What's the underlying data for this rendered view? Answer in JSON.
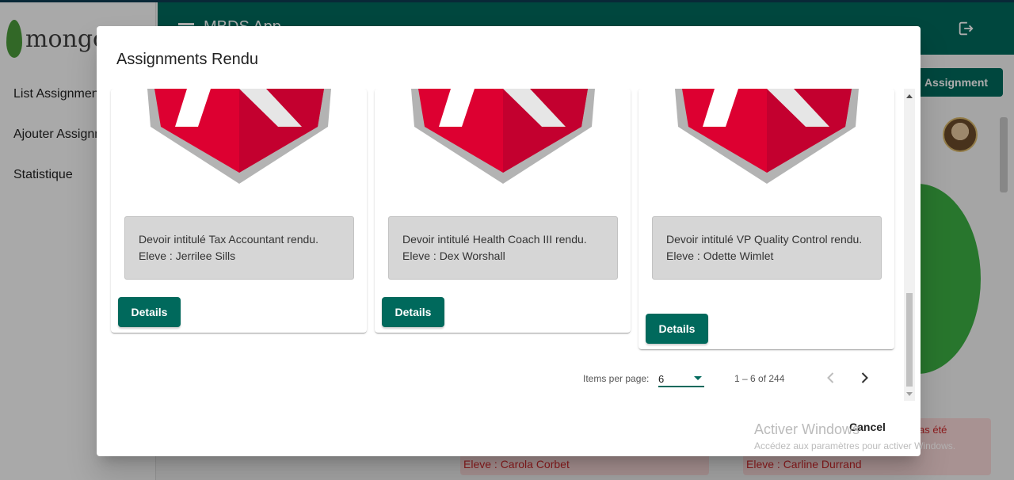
{
  "app": {
    "logo_text": "mongo",
    "title": "MBDS App",
    "sidebar": [
      {
        "label": "List Assignments"
      },
      {
        "label": "Ajouter Assignment"
      },
      {
        "label": "Statistique"
      }
    ],
    "add_button": "Assignment",
    "bg_cards": [
      {
        "eleve": "Eleve : Carola Corbet"
      },
      {
        "eleve": "Eleve : Carline Durrand",
        "status": "as été"
      }
    ]
  },
  "dialog": {
    "title": "Assignments Rendu",
    "cards": [
      {
        "line1": "Devoir intitulé Tax Accountant rendu.",
        "line2": "Eleve : Jerrilee Sills",
        "button": "Details"
      },
      {
        "line1": "Devoir intitulé Health Coach III rendu.",
        "line2": "Eleve : Dex Worshall",
        "button": "Details"
      },
      {
        "line1": "Devoir intitulé VP Quality Control rendu.",
        "line2": "Eleve : Odette Wimlet",
        "button": "Details"
      }
    ],
    "paginator": {
      "items_per_page_label": "Items per page:",
      "items_per_page_value": "6",
      "range_label": "1 – 6 of 244"
    },
    "cancel_label": "Cancel"
  },
  "watermark": {
    "line1": "Activer Windows",
    "line2": "Accédez aux paramètres pour activer Windows."
  },
  "colors": {
    "primary": "#00695c",
    "angular_red": "#dd0031",
    "angular_dark_red": "#c3002f",
    "angular_grey": "#b3b3b3"
  }
}
